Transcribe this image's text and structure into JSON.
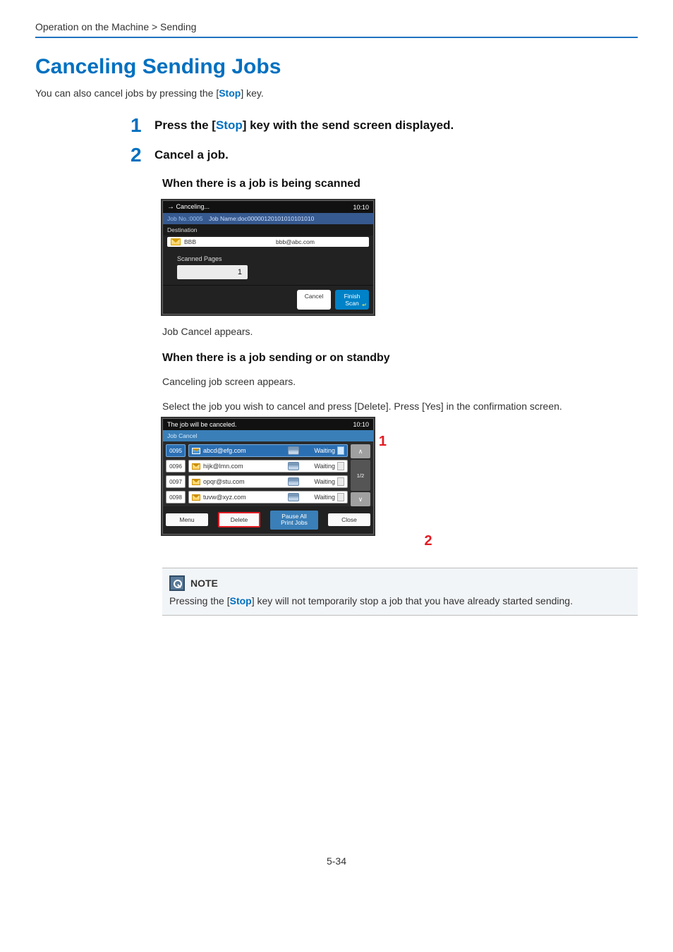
{
  "breadcrumb": "Operation on the Machine > Sending",
  "h1": "Canceling Sending Jobs",
  "intro_pre": "You can also cancel jobs by pressing the [",
  "intro_key": "Stop",
  "intro_post": "] key.",
  "steps": {
    "s1": {
      "num": "1",
      "pre": "Press the [",
      "key": "Stop",
      "post": "] key with the send screen displayed."
    },
    "s2": {
      "num": "2",
      "title": "Cancel a job."
    }
  },
  "scan": {
    "heading": "When there is a job is being scanned",
    "panel": {
      "header": "Canceling...",
      "time": "10:10",
      "jobno_label": "Job No.:0005",
      "jobname": "Job Name:doc00000120101010101010",
      "dest_label": "Destination",
      "dest_name": "BBB",
      "dest_addr": "bbb@abc.com",
      "scanned_label": "Scanned Pages",
      "scanned_value": "1",
      "btn_cancel": "Cancel",
      "btn_finish": "Finish\nScan"
    },
    "caption": "Job Cancel appears."
  },
  "standby": {
    "heading": "When there is a job sending or on standby",
    "text1": "Canceling job screen appears.",
    "text2": "Select the job you wish to cancel and press [Delete]. Press [Yes] in the confirmation screen.",
    "panel": {
      "header": "The job will be canceled.",
      "time": "10:10",
      "sub": "Job Cancel",
      "rows": [
        {
          "id": "0095",
          "addr": "abcd@efg.com",
          "status": "Waiting",
          "selected": true
        },
        {
          "id": "0096",
          "addr": "hijk@lmn.com",
          "status": "Waiting",
          "selected": false
        },
        {
          "id": "0097",
          "addr": "opqr@stu.com",
          "status": "Waiting",
          "selected": false
        },
        {
          "id": "0098",
          "addr": "tuvw@xyz.com",
          "status": "Waiting",
          "selected": false
        }
      ],
      "page_ind": "1/2",
      "btn_menu": "Menu",
      "btn_delete": "Delete",
      "btn_pause": "Pause All\nPrint Jobs",
      "btn_close": "Close"
    },
    "callout1": "1",
    "callout2": "2"
  },
  "note": {
    "title": "NOTE",
    "pre": "Pressing the [",
    "key": "Stop",
    "post": "] key will not temporarily stop a job that you have already started sending."
  },
  "footer": "5-34"
}
